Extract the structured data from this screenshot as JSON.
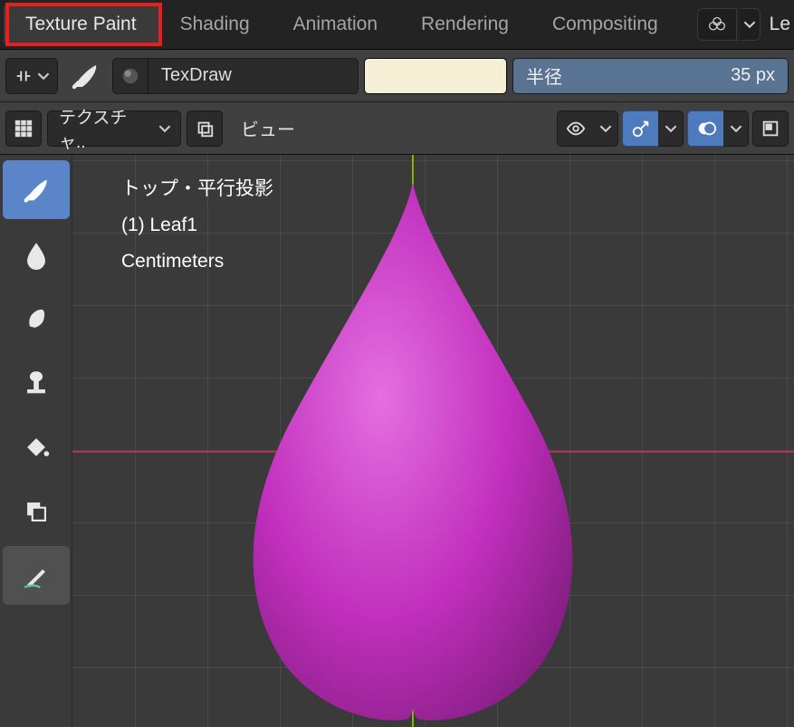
{
  "tabs": {
    "items": [
      "Texture Paint",
      "Shading",
      "Animation",
      "Rendering",
      "Compositing"
    ],
    "truncated": "Le"
  },
  "toolbar": {
    "brush_name": "TexDraw",
    "radius_label": "半径",
    "radius_value": "35 px"
  },
  "header": {
    "mode_label": "テクスチャ..",
    "menu_view": "ビュー"
  },
  "overlay": {
    "line1": "トップ・平行投影",
    "line2": "(1) Leaf1",
    "line3": "Centimeters"
  },
  "colors": {
    "swatch": "#f5efd5",
    "accent_blue": "#4e7bbd",
    "radius_bg": "#597392",
    "highlight_red": "#e62020",
    "leaf_fill": "#c12fbd"
  }
}
